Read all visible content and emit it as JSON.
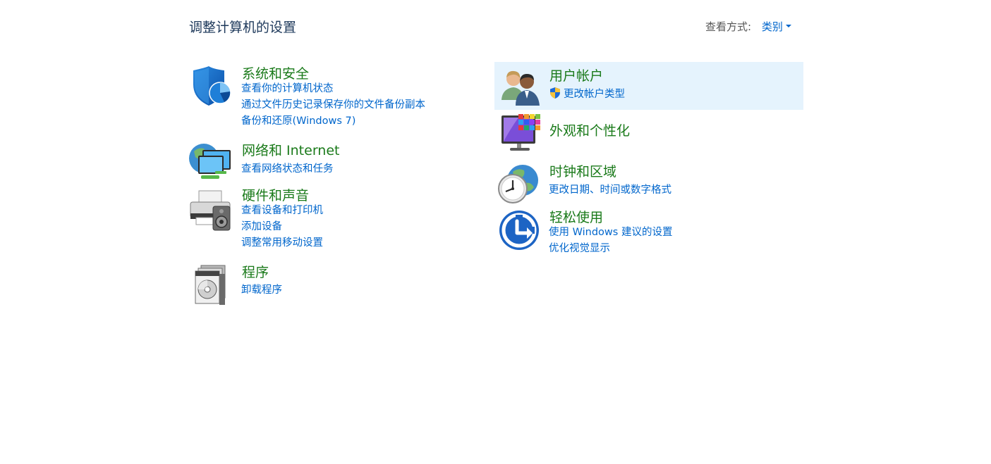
{
  "header": {
    "title": "调整计算机的设置",
    "view_by_label": "查看方式:",
    "view_by_value": "类别"
  },
  "left_categories": [
    {
      "title": "系统和安全",
      "icon": "security-shield-icon",
      "links": [
        "查看你的计算机状态",
        "通过文件历史记录保存你的文件备份副本",
        "备份和还原(Windows 7)"
      ]
    },
    {
      "title": "网络和 Internet",
      "icon": "network-globe-icon",
      "links": [
        "查看网络状态和任务"
      ]
    },
    {
      "title": "硬件和声音",
      "icon": "printer-speaker-icon",
      "links": [
        "查看设备和打印机",
        "添加设备",
        "调整常用移动设置"
      ]
    },
    {
      "title": "程序",
      "icon": "programs-disc-icon",
      "links": [
        "卸载程序"
      ]
    }
  ],
  "right_categories": [
    {
      "title": "用户帐户",
      "icon": "user-accounts-icon",
      "links": [
        "更改帐户类型"
      ]
    },
    {
      "title": "外观和个性化",
      "icon": "appearance-monitor-icon",
      "links": []
    },
    {
      "title": "时钟和区域",
      "icon": "clock-globe-icon",
      "links": [
        "更改日期、时间或数字格式"
      ]
    },
    {
      "title": "轻松使用",
      "icon": "ease-of-access-icon",
      "links": [
        "使用 Windows 建议的设置",
        "优化视觉显示"
      ]
    }
  ],
  "colors": {
    "title_text": "#1e395b",
    "category_title": "#1a7a1a",
    "link": "#0066cc",
    "hover_bg": "#e5f3fd"
  }
}
